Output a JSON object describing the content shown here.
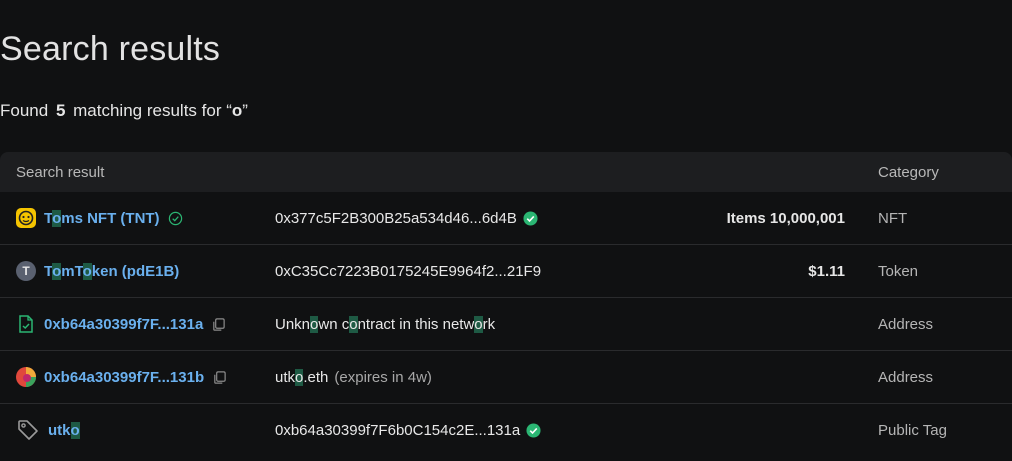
{
  "page": {
    "title": "Search results",
    "found_prefix": "Found",
    "found_count": "5",
    "found_middle": "matching results for “",
    "found_query": "o",
    "found_suffix": "”"
  },
  "table": {
    "headers": {
      "result": "Search result",
      "category": "Category"
    },
    "rows": [
      {
        "name_parts": [
          "T",
          "o",
          "ms NFT (TNT)"
        ],
        "address": "0x377c5F2B300B25a534d46...6d4B",
        "extra_label": "Items",
        "extra_value": "10,000,001",
        "category": "NFT"
      },
      {
        "avatar_letter": "T",
        "name_parts": [
          "T",
          "o",
          "mT",
          "o",
          "ken (pdE1B)"
        ],
        "address": "0xC35Cc7223B0175245E9964f2...21F9",
        "extra_value": "$1.11",
        "category": "Token"
      },
      {
        "name": "0xb64a30399f7F...131a",
        "desc_parts": [
          "Unkn",
          "o",
          "wn c",
          "o",
          "ntract in this netw",
          "o",
          "rk"
        ],
        "category": "Address"
      },
      {
        "name": "0xb64a30399f7F...131b",
        "desc_parts": [
          "utk",
          "o",
          ".eth"
        ],
        "desc_note": "(expires in 4w)",
        "category": "Address"
      },
      {
        "name_parts": [
          "utk",
          "o"
        ],
        "address": "0xb64a30399f7F6b0C154c2E...131a",
        "category": "Public Tag"
      }
    ]
  },
  "colors": {
    "background": "#101112",
    "link": "#6ab0ee",
    "highlight": "#1e5a44",
    "verified": "#2bb673"
  }
}
